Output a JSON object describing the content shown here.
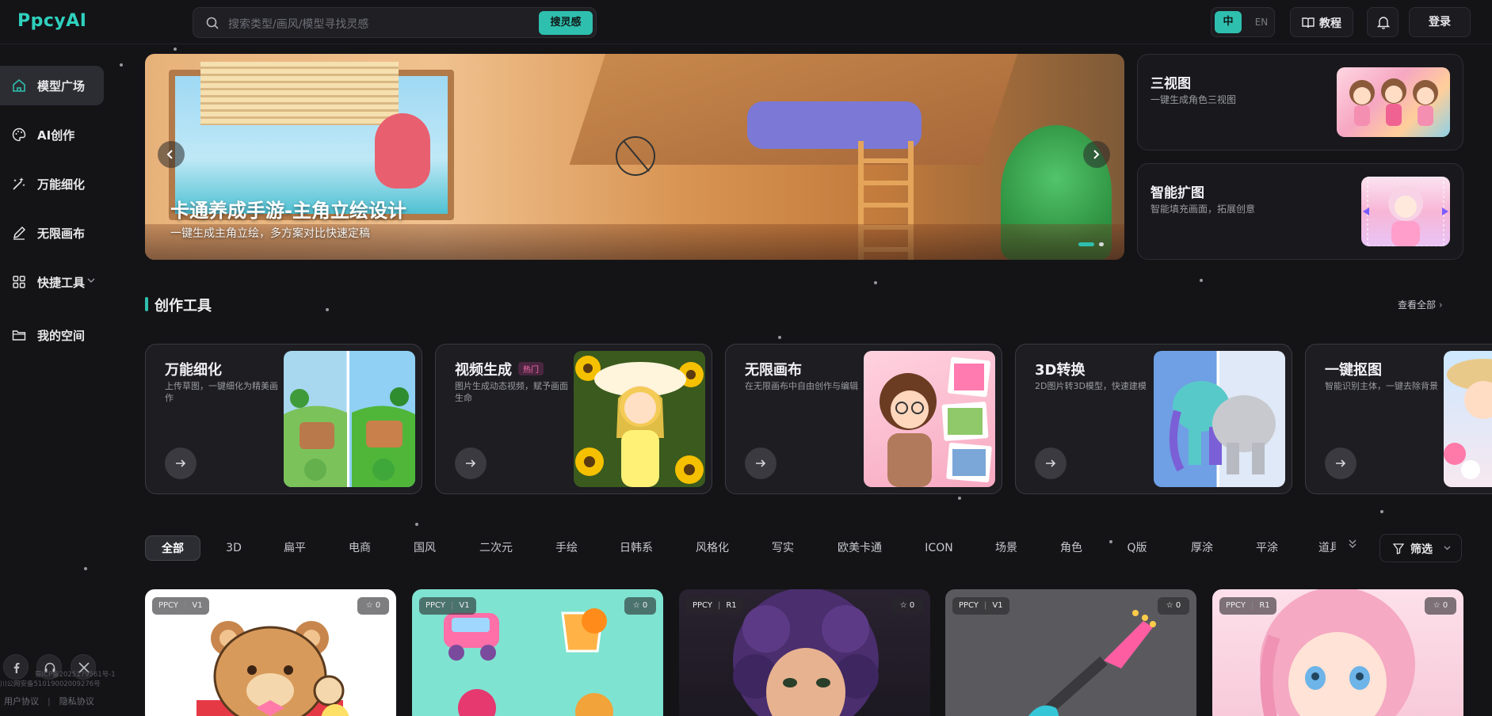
{
  "header": {
    "logo": "PpcyAI",
    "search_placeholder": "搜索类型/画风/模型寻找灵感",
    "search_button": "搜灵感",
    "lang_zh": "中",
    "lang_en": "EN",
    "tutorial": "教程",
    "login": "登录"
  },
  "sidebar": {
    "items": [
      {
        "label": "模型广场",
        "icon": "home-icon",
        "active": true
      },
      {
        "label": "AI创作",
        "icon": "palette-icon"
      },
      {
        "label": "万能细化",
        "icon": "magic-wand-icon"
      },
      {
        "label": "无限画布",
        "icon": "pen-icon"
      },
      {
        "label": "快捷工具",
        "icon": "grid-icon"
      },
      {
        "label": "我的空间",
        "icon": "folder-icon"
      }
    ],
    "social": [
      "facebook-icon",
      "headset-icon",
      "x-icon"
    ],
    "user_agreement": "用户协议",
    "privacy": "隐私协议",
    "icp1": "蜀ICP备2025179561号-1",
    "icp2": "川公网安备51019002009276号"
  },
  "banner": {
    "title": "卡通养成手游-主角立绘设计",
    "subtitle": "一键生成主角立绘，多方案对比快速定稿"
  },
  "side_cards": [
    {
      "title": "三视图",
      "desc": "一键生成角色三视图"
    },
    {
      "title": "智能扩图",
      "desc": "智能填充画面，拓展创意"
    }
  ],
  "tools_section": {
    "title": "创作工具",
    "view_all": "查看全部",
    "tools": [
      {
        "title": "万能细化",
        "desc": "上传草图，一键细化为精美画作",
        "badge": ""
      },
      {
        "title": "视频生成",
        "desc": "图片生成动态视频，赋予画面生命",
        "badge": "热门"
      },
      {
        "title": "无限画布",
        "desc": "在无限画布中自由创作与编辑",
        "badge": ""
      },
      {
        "title": "3D转换",
        "desc": "2D图片转3D模型，快速建模",
        "badge": ""
      },
      {
        "title": "一键抠图",
        "desc": "智能识别主体，一键去除背景",
        "badge": ""
      }
    ]
  },
  "filters": {
    "categories": [
      "全部",
      "3D",
      "扁平",
      "电商",
      "国风",
      "二次元",
      "手绘",
      "日韩系",
      "风格化",
      "写实",
      "欧美卡通",
      "ICON",
      "场景",
      "角色",
      "Q版",
      "厚涂",
      "平涂",
      "道具"
    ],
    "filter_button": "筛选"
  },
  "gallery": [
    {
      "brand": "PPCY",
      "version": "V1",
      "stars": "0"
    },
    {
      "brand": "PPCY",
      "version": "V1",
      "stars": "0"
    },
    {
      "brand": "PPCY",
      "version": "R1",
      "stars": "0"
    },
    {
      "brand": "PPCY",
      "version": "V1",
      "stars": "0"
    },
    {
      "brand": "PPCY",
      "version": "R1",
      "stars": "0"
    }
  ],
  "colors": {
    "accent": "#2fbfae",
    "background": "#141417"
  }
}
